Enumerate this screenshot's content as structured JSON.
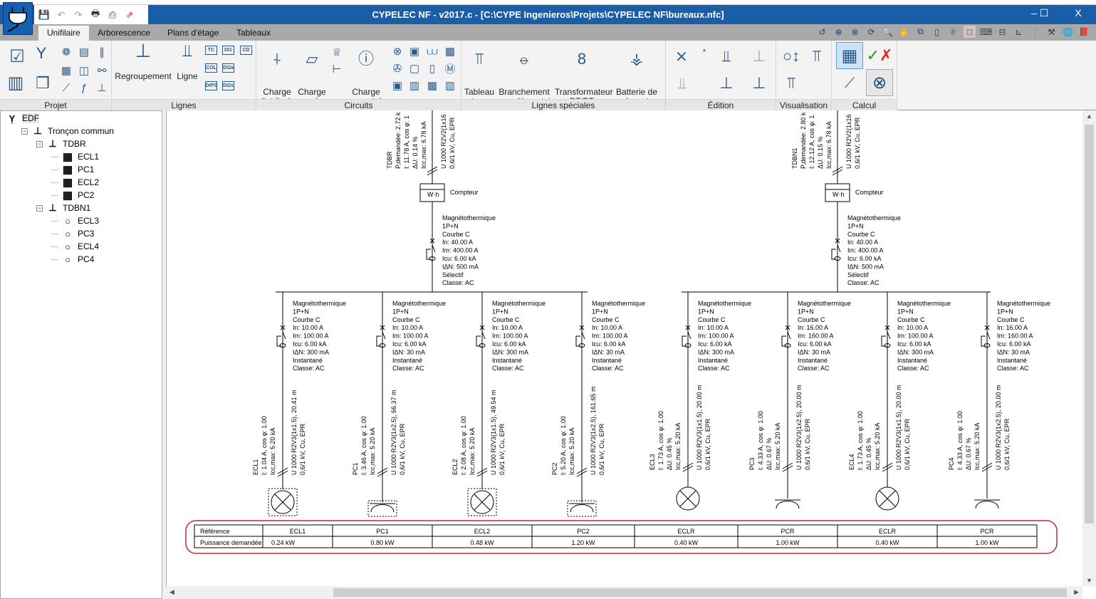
{
  "window": {
    "title": "CYPELEC NF - v2017.c - [C:\\CYPE Ingenieros\\Projets\\CYPELEC NF\\bureaux.nfc]",
    "minimize": "–",
    "maximize": "☐",
    "close": "X"
  },
  "tabs": [
    {
      "label": "Unifilaire",
      "active": true
    },
    {
      "label": "Arborescence"
    },
    {
      "label": "Plans d'étage"
    },
    {
      "label": "Tableaux"
    }
  ],
  "ribbon": {
    "groups": {
      "projet": "Projet",
      "lignes": "Lignes",
      "circuits": "Circuits",
      "lignes_speciales": "Lignes spéciales",
      "edition": "Édition",
      "visualisation": "Visualisation",
      "calcul": "Calcul"
    },
    "buttons": {
      "regroupement": "Regroupement",
      "ligne": "Ligne",
      "charge_distribuee": "Charge\ndistribuée",
      "charge_plan": "Charge\nsur plan",
      "charge_concentree": "Charge\nconcentrée",
      "tableau_type": "Tableau\ntype",
      "branchement": "Branchement\ncomplémentaire",
      "transformateur": "Transformateur\nBT/BT",
      "batterie": "Batterie de\ncondensateurs"
    },
    "small_boxes": [
      "TC",
      "DI1",
      "CD",
      "COL",
      "DI2a",
      "DIPS",
      "DI2s"
    ]
  },
  "tree": [
    {
      "label": "EDF",
      "level": 0,
      "icon": "supply-icon"
    },
    {
      "label": "Tronçon commun",
      "level": 1,
      "icon": "line-icon"
    },
    {
      "label": "TDBR",
      "level": 2,
      "icon": "line-icon"
    },
    {
      "label": "ECL1",
      "level": 3,
      "icon": "panel-icon"
    },
    {
      "label": "PC1",
      "level": 3,
      "icon": "panel-icon"
    },
    {
      "label": "ECL2",
      "level": 3,
      "icon": "panel-icon"
    },
    {
      "label": "PC2",
      "level": 3,
      "icon": "panel-icon"
    },
    {
      "label": "TDBN1",
      "level": 2,
      "icon": "line-icon"
    },
    {
      "label": "ECL3",
      "level": 3,
      "icon": "circle-icon"
    },
    {
      "label": "PC3",
      "level": 3,
      "icon": "circle-icon"
    },
    {
      "label": "ECL4",
      "level": 3,
      "icon": "circle-icon"
    },
    {
      "label": "PC4",
      "level": 3,
      "icon": "circle-icon"
    }
  ],
  "diagram": {
    "feeders": [
      {
        "name": "TDBR",
        "info": [
          "TDBR",
          "P,demandée: 2.72 k",
          "I: 11.78 A, cos φ: 1",
          "ΔU: 0.14 %",
          "Icc,max: 6.78 kA"
        ],
        "cable": [
          "U 1000 R2V2(1x16",
          "0,6/1 kV, Cu, EPR"
        ],
        "meter": "Compteur",
        "meter_unit": "W·h",
        "breaker": [
          "Magnétothermique",
          "1P+N",
          "Courbe C",
          "In: 40.00 A",
          "Im: 400.00 A",
          "Icu: 6.00 kA",
          "IΔN: 500 mA",
          "Sélectif",
          "Classe: AC"
        ]
      },
      {
        "name": "TDBN1",
        "info": [
          "TDBN1",
          "P,demandée: 2.80 k",
          "I: 12.12 A, cos φ: 1",
          "ΔU: 0.15 %",
          "Icc,max: 6.78 kA"
        ],
        "cable": [
          "U 1000 R2V2(1x16",
          "0,6/1 kV, Cu, EPR"
        ],
        "meter": "Compteur",
        "meter_unit": "W·h",
        "breaker": [
          "Magnétothermique",
          "1P+N",
          "Courbe C",
          "In: 40.00 A",
          "Im: 400.00 A",
          "Icu: 6.00 kA",
          "IΔN: 500 mA",
          "Sélectif",
          "Classe: AC"
        ]
      }
    ],
    "circuits": [
      {
        "name": "ECL1",
        "feeder": 0,
        "load": "lamp",
        "info": [
          "ECL1",
          "I: 1.04 A, cos φ: 1.00",
          "Icc,max: 5.20 kA"
        ],
        "cable": [
          "U 1000 R2V3(1x1.5), 20.41 m",
          "0,6/1 kV, Cu, EPR"
        ],
        "breaker": [
          "Magnétothermique",
          "1P+N",
          "Courbe C",
          "In: 10.00 A",
          "Im: 100.00 A",
          "Icu: 6.00 kA",
          "IΔN: 300 mA",
          "Instantané",
          "Classe: AC"
        ]
      },
      {
        "name": "PC1",
        "feeder": 0,
        "load": "socket",
        "info": [
          "PC1",
          "I: 3.46 A, cos φ: 1.00",
          "Icc,max: 5.20 kA"
        ],
        "cable": [
          "U 1000 R2V3(1x2.5), 66.37 m",
          "0,6/1 kV, Cu, EPR"
        ],
        "breaker": [
          "Magnétothermique",
          "1P+N",
          "Courbe C",
          "In: 10.00 A",
          "Im: 100.00 A",
          "Icu: 6.00 kA",
          "IΔN: 30 mA",
          "Instantané",
          "Classe: AC"
        ]
      },
      {
        "name": "ECL2",
        "feeder": 0,
        "load": "lamp",
        "info": [
          "ECL2",
          "I: 2.08 A, cos φ: 1.00",
          "Icc,max: 5.20 kA"
        ],
        "cable": [
          "U 1000 R2V3(1x1.5), 49.54 m",
          "0,6/1 kV, Cu, EPR"
        ],
        "breaker": [
          "Magnétothermique",
          "1P+N",
          "Courbe C",
          "In: 10.00 A",
          "Im: 100.00 A",
          "Icu: 6.00 kA",
          "IΔN: 300 mA",
          "Instantané",
          "Classe: AC"
        ]
      },
      {
        "name": "PC2",
        "feeder": 0,
        "load": "socket",
        "info": [
          "PC2",
          "I: 5.20 A, cos φ: 1.00",
          "Icc,max: 5.20 kA"
        ],
        "cable": [
          "U 1000 R2V3(1x2.5), 161.65 m",
          "0,6/1 kV, Cu, EPR"
        ],
        "breaker": [
          "Magnétothermique",
          "1P+N",
          "Courbe C",
          "In: 10.00 A",
          "Im: 100.00 A",
          "Icu: 6.00 kA",
          "IΔN: 30 mA",
          "Instantané",
          "Classe: AC"
        ]
      },
      {
        "name": "ECL3",
        "feeder": 1,
        "load": "lamp2",
        "info": [
          "ECL3",
          "I: 1.73 A, cos φ: 1.00",
          "ΔU: 0.45 %",
          "Icc,max: 5.20 kA"
        ],
        "cable": [
          "U 1000 R2V3(1x1.5), 20.00 m",
          "0,6/1 kV, Cu, EPR"
        ],
        "breaker": [
          "Magnétothermique",
          "1P+N",
          "Courbe C",
          "In: 10.00 A",
          "Im: 100.00 A",
          "Icu: 6.00 kA",
          "IΔN: 300 mA",
          "Instantané",
          "Classe: AC"
        ]
      },
      {
        "name": "PC3",
        "feeder": 1,
        "load": "socket2",
        "info": [
          "PC3",
          "I: 4.33 A, cos φ: 1.00",
          "ΔU: 0.67 %",
          "Icc,max: 5.20 kA"
        ],
        "cable": [
          "U 1000 R2V3(1x2.5), 20.00 m",
          "0,6/1 kV, Cu, EPR"
        ],
        "breaker": [
          "Magnétothermique",
          "1P+N",
          "Courbe C",
          "In: 16.00 A",
          "Im: 160.00 A",
          "Icu: 6.00 kA",
          "IΔN: 30 mA",
          "Instantané",
          "Classe: AC"
        ]
      },
      {
        "name": "ECL4",
        "feeder": 1,
        "load": "lamp2",
        "info": [
          "ECL4",
          "I: 1.73 A, cos φ: 1.00",
          "ΔU: 0.45 %",
          "Icc,max: 5.20 kA"
        ],
        "cable": [
          "U 1000 R2V3(1x1.5), 20.00 m",
          "0,6/1 kV, Cu, EPR"
        ],
        "breaker": [
          "Magnétothermique",
          "1P+N",
          "Courbe C",
          "In: 10.00 A",
          "Im: 100.00 A",
          "Icu: 6.00 kA",
          "IΔN: 300 mA",
          "Instantané",
          "Classe: AC"
        ]
      },
      {
        "name": "PC4",
        "feeder": 1,
        "load": "socket2",
        "info": [
          "PC4",
          "I: 4.33 A, cos φ: 1.00",
          "ΔU: 0.67 %",
          "Icc,max: 5.20 kA"
        ],
        "cable": [
          "U 1000 R2V3(1x2.5), 20.00 m",
          "0,6/1 kV, Cu, EPR"
        ],
        "breaker": [
          "Magnétothermique",
          "1P+N",
          "Courbe C",
          "In: 16.00 A",
          "Im: 160.00 A",
          "Icu: 6.00 kA",
          "IΔN: 30 mA",
          "Instantané",
          "Classe: AC"
        ]
      }
    ],
    "table": {
      "row_labels": [
        "Référence",
        "Puissance demandée"
      ],
      "references": [
        "ECL1",
        "PC1",
        "ECL2",
        "PC2",
        "ECLR",
        "PCR",
        "ECLR",
        "PCR"
      ],
      "powers": [
        "0.24 kW",
        "0.80 kW",
        "0.48 kW",
        "1.20 kW",
        "0.40 kW",
        "1.00 kW",
        "0.40 kW",
        "1.00 kW"
      ],
      "highlight_color": "#c0282d"
    }
  },
  "colors": {
    "titlebar": "#1a5ea8",
    "ribbon": "#f3f3f3",
    "icon": "#2b5a8a"
  }
}
